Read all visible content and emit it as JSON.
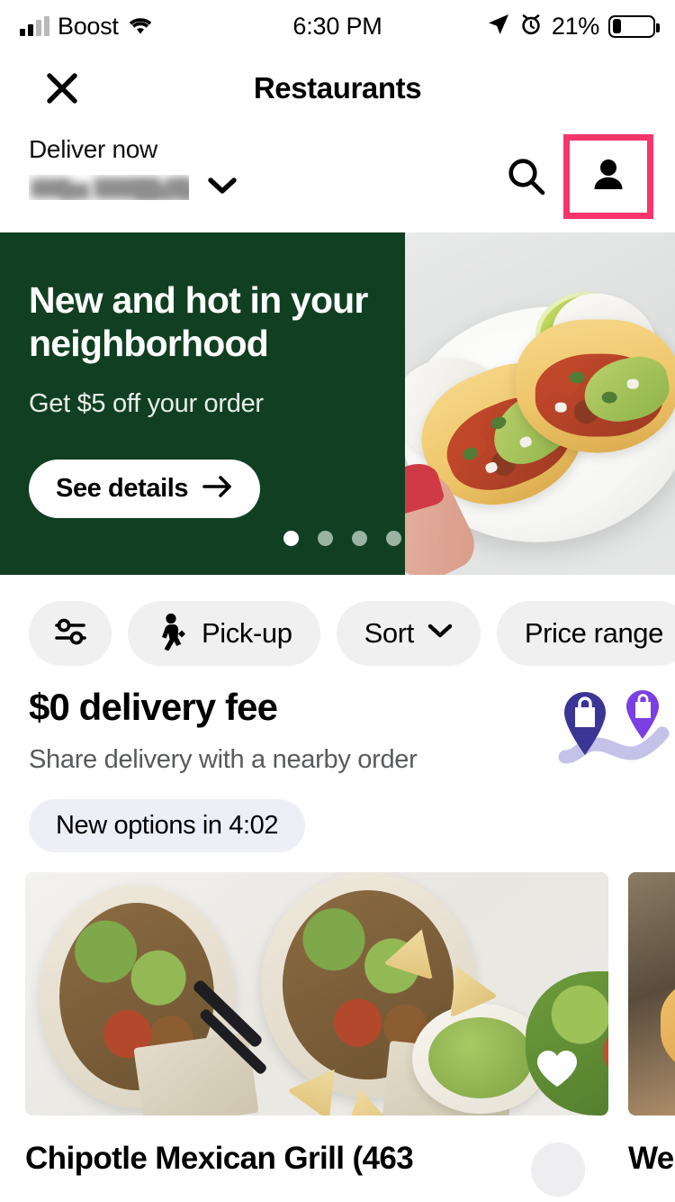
{
  "status_bar": {
    "carrier": "Boost",
    "time": "6:30 PM",
    "battery_percent": "21%",
    "icons": [
      "signal-icon",
      "wifi-icon",
      "location-arrow-icon",
      "alarm-clock-icon",
      "battery-icon"
    ]
  },
  "nav": {
    "close_icon": "close-icon",
    "title": "Restaurants"
  },
  "address_header": {
    "deliver_label": "Deliver now",
    "address_value": "",
    "address_redacted": true,
    "chevron_icon": "chevron-down-icon",
    "search_icon": "search-icon",
    "profile_icon": "person-icon",
    "highlight_color": "#f5356c"
  },
  "promo_banner": {
    "headline": "New and hot in your neighborhood",
    "subtext": "Get $5 off your order",
    "cta_label": "See details",
    "cta_arrow_icon": "arrow-right-icon",
    "background_color": "#113f22",
    "image_alt": "two tacos on a white plate with lime",
    "dots": {
      "total": 4,
      "active_index": 0
    }
  },
  "filter_chips": [
    {
      "name": "filters",
      "label": "",
      "icon": "sliders-icon",
      "icon_only": true
    },
    {
      "name": "pickup",
      "label": "Pick-up",
      "icon": "walking-person-icon",
      "icon_only": false
    },
    {
      "name": "sort",
      "label": "Sort",
      "icon": "chevron-down-icon",
      "icon_only": false
    },
    {
      "name": "price-range",
      "label": "Price range",
      "icon": "",
      "icon_only": false
    }
  ],
  "delivery_fee_section": {
    "title": "$0 delivery fee",
    "subtitle": "Share delivery with a nearby order",
    "badge_label": "New options in 4:02",
    "illustration": "two-map-pins-icon",
    "pin_color_dark": "#3b3596",
    "pin_color_light": "#7b3fe4",
    "path_color": "#bdb9e8"
  },
  "restaurant_cards": [
    {
      "name": "Chipotle Mexican Grill (463",
      "image_alt": "chipotle burrito bowls with guacamole and chips",
      "favorite_icon": "heart-icon",
      "favorited": true
    },
    {
      "name": "We",
      "image_alt": "sandwich on wooden board with menu board behind",
      "favorite_icon": "heart-icon",
      "favorited": false
    }
  ]
}
